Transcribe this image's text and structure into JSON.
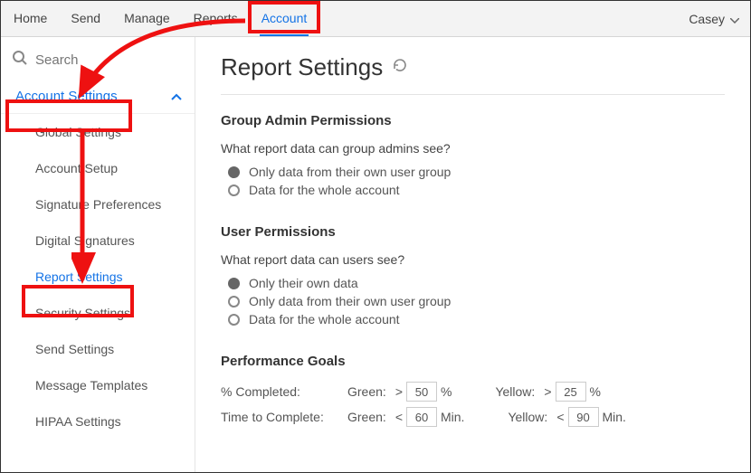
{
  "topnav": {
    "tabs": [
      "Home",
      "Send",
      "Manage",
      "Reports",
      "Account"
    ],
    "active": "Account",
    "user": "Casey"
  },
  "sidebar": {
    "search_placeholder": "Search",
    "section_title": "Account Settings",
    "items": [
      "Global Settings",
      "Account Setup",
      "Signature Preferences",
      "Digital Signatures",
      "Report Settings",
      "Security Settings",
      "Send Settings",
      "Message Templates",
      "HIPAA Settings"
    ],
    "active_item": "Report Settings"
  },
  "main": {
    "title": "Report Settings",
    "group_hdr": "Group Admin Permissions",
    "group_q": "What report data can group admins see?",
    "group_opts": [
      "Only data from their own user group",
      "Data for the whole account"
    ],
    "group_selected": 0,
    "user_hdr": "User Permissions",
    "user_q": "What report data can users see?",
    "user_opts": [
      "Only their own data",
      "Only data from their own user group",
      "Data for the whole account"
    ],
    "user_selected": 0,
    "perf_hdr": "Performance Goals",
    "perf": {
      "pct_label": "% Completed:",
      "time_label": "Time to Complete:",
      "green": "Green:",
      "yellow": "Yellow:",
      "gt": ">",
      "lt": "<",
      "pct_unit": "%",
      "min_unit": "Min.",
      "pct_green": "50",
      "pct_yellow": "25",
      "time_green": "60",
      "time_yellow": "90"
    }
  }
}
